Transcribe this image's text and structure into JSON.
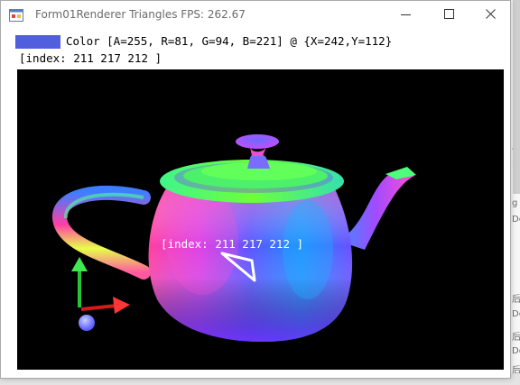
{
  "window": {
    "title": "Form01Renderer Triangles FPS: 262.67",
    "controls": [
      "minimize-icon",
      "maximize-icon",
      "close-icon"
    ]
  },
  "info": {
    "swatch_color": "#515EDD",
    "color_line": "Color [A=255, R=81, G=94, B=221] @ {X=242,Y=112}",
    "index_line": "[index: 211 217 212 ]"
  },
  "viewport": {
    "overlay_label": "[index: 211 217 212 ]",
    "background": "#000000",
    "axes_icon": "xyz-axes-gizmo"
  },
  "background_app": {
    "glyphs": [
      "后",
      "De",
      "g",
      "De",
      "后",
      "De",
      "后",
      "De",
      "后"
    ]
  }
}
